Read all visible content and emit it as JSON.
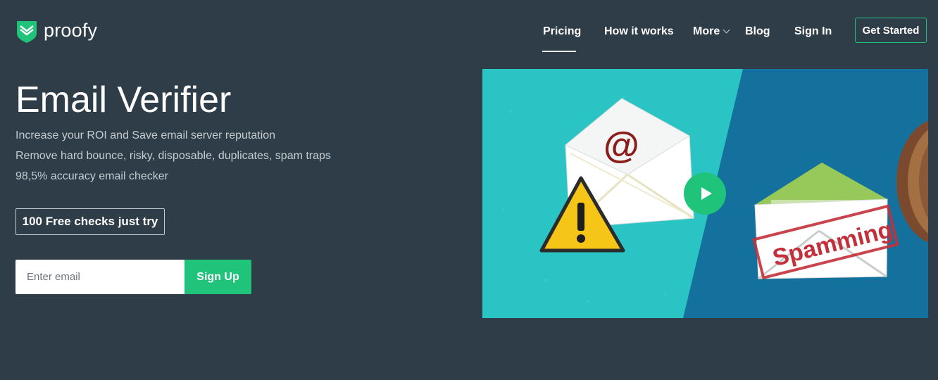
{
  "brand": {
    "name": "proofy",
    "logo_icon": "shield-envelope-icon",
    "accent": "#1fc37a"
  },
  "nav": {
    "items": [
      {
        "label": "Pricing",
        "active": true
      },
      {
        "label": "How it works"
      },
      {
        "label": "More",
        "has_dropdown": true
      },
      {
        "label": "Blog"
      },
      {
        "label": "Sign In"
      }
    ],
    "cta": "Get Started"
  },
  "hero": {
    "title": "Email Verifier",
    "lines": [
      "Increase your ROI and Save email server reputation",
      "Remove hard bounce,  risky,  disposable, duplicates, spam traps",
      "98,5% accuracy email checker"
    ],
    "trial_button": "100 Free checks just try",
    "email_placeholder": "Enter email",
    "signup_button": "Sign Up"
  },
  "video": {
    "at_sign": "@",
    "stamp_text": "Spamming",
    "play_icon": "play-icon",
    "colors": {
      "left": "#2bc4c4",
      "right": "#14709c"
    }
  }
}
